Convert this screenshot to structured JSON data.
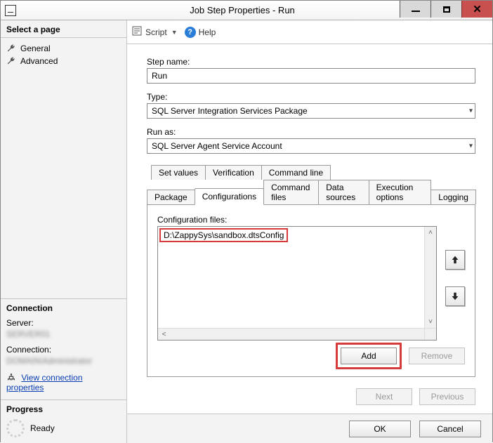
{
  "window": {
    "title": "Job Step Properties - Run"
  },
  "sidebar": {
    "select_page": "Select a page",
    "pages": [
      {
        "label": "General"
      },
      {
        "label": "Advanced"
      }
    ],
    "connection": {
      "header": "Connection",
      "server_label": "Server:",
      "server_value": "SERVER01",
      "connection_label": "Connection:",
      "connection_value": "DOMAIN\\Administrator",
      "view_props_label": "View connection properties"
    },
    "progress": {
      "header": "Progress",
      "status": "Ready"
    }
  },
  "toolbar": {
    "script_label": "Script",
    "help_label": "Help"
  },
  "form": {
    "step_name_label": "Step name:",
    "step_name_value": "Run",
    "type_label": "Type:",
    "type_value": "SQL Server Integration Services Package",
    "run_as_label": "Run as:",
    "run_as_value": "SQL Server Agent Service Account"
  },
  "tabs": {
    "row1": [
      {
        "label": "Set values"
      },
      {
        "label": "Verification"
      },
      {
        "label": "Command line"
      }
    ],
    "row2": [
      {
        "label": "Package"
      },
      {
        "label": "Configurations",
        "active": true
      },
      {
        "label": "Command files"
      },
      {
        "label": "Data sources"
      },
      {
        "label": "Execution options"
      },
      {
        "label": "Logging"
      }
    ]
  },
  "config_panel": {
    "list_label": "Configuration files:",
    "items": [
      "D:\\ZappySys\\sandbox.dtsConfig"
    ],
    "add_label": "Add",
    "remove_label": "Remove"
  },
  "nav_buttons": {
    "next": "Next",
    "previous": "Previous"
  },
  "dialog_buttons": {
    "ok": "OK",
    "cancel": "Cancel"
  }
}
